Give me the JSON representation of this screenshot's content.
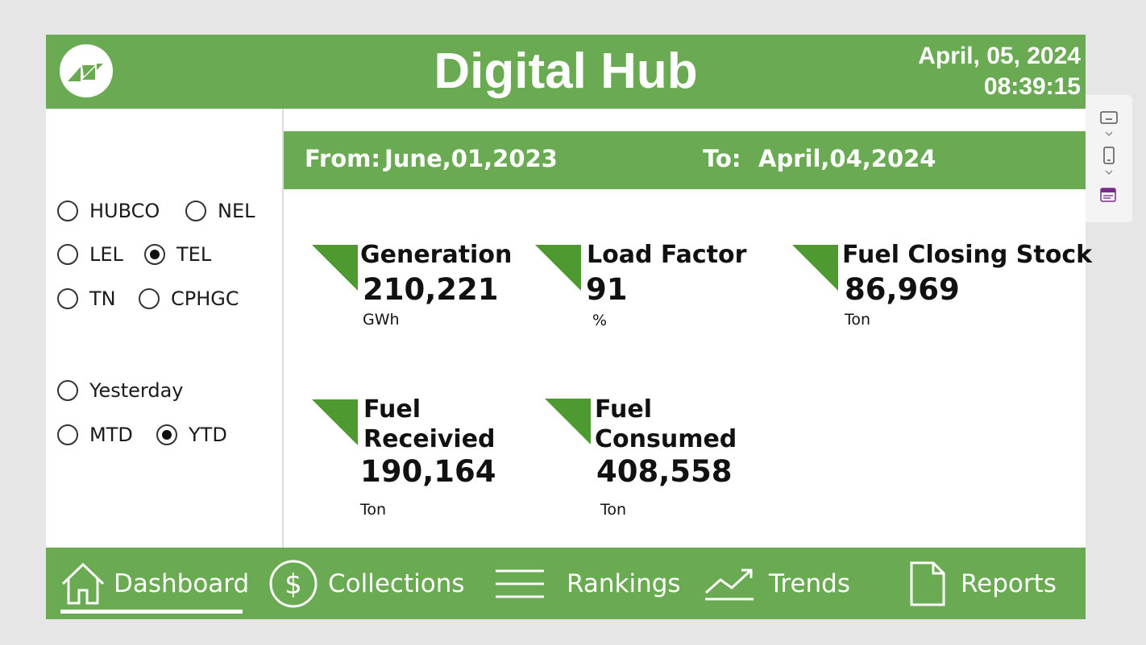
{
  "header": {
    "title": "Digital Hub",
    "date": "April, 05, 2024",
    "time": "08:39:15",
    "logo_icon": "hub-logo-icon"
  },
  "date_range": {
    "from_label": "From:",
    "from_value": "June,01,2023",
    "to_label": "To:",
    "to_value": "April,04,2024"
  },
  "company_options": [
    {
      "label": "HUBCO",
      "selected": false
    },
    {
      "label": "NEL",
      "selected": false
    },
    {
      "label": "LEL",
      "selected": false
    },
    {
      "label": "TEL",
      "selected": true
    },
    {
      "label": "TN",
      "selected": false
    },
    {
      "label": "CPHGC",
      "selected": false
    }
  ],
  "period_options": [
    {
      "label": "Yesterday",
      "selected": false
    },
    {
      "label": "MTD",
      "selected": false
    },
    {
      "label": "YTD",
      "selected": true
    }
  ],
  "kpis": [
    {
      "label": "Generation",
      "value": "210,221",
      "unit": "GWh"
    },
    {
      "label": "Load Factor",
      "value": "91",
      "unit": "%"
    },
    {
      "label": "Fuel Closing Stock",
      "value": "86,969",
      "unit": "Ton"
    },
    {
      "label_line1": "Fuel",
      "label_line2": "Receivied",
      "value": "190,164",
      "unit": "Ton"
    },
    {
      "label_line1": "Fuel",
      "label_line2": "Consumed",
      "value": "408,558",
      "unit": "Ton"
    }
  ],
  "nav": [
    {
      "label": "Dashboard",
      "icon": "home-icon",
      "active": true
    },
    {
      "label": "Collections",
      "icon": "dollar-circle-icon",
      "active": false
    },
    {
      "label": "Rankings",
      "icon": "list-lines-icon",
      "active": false
    },
    {
      "label": "Trends",
      "icon": "trend-line-icon",
      "active": false
    },
    {
      "label": "Reports",
      "icon": "document-icon",
      "active": false
    }
  ],
  "colors": {
    "brand_green": "#6aaa52",
    "kpi_triangle": "#4f9a30"
  }
}
